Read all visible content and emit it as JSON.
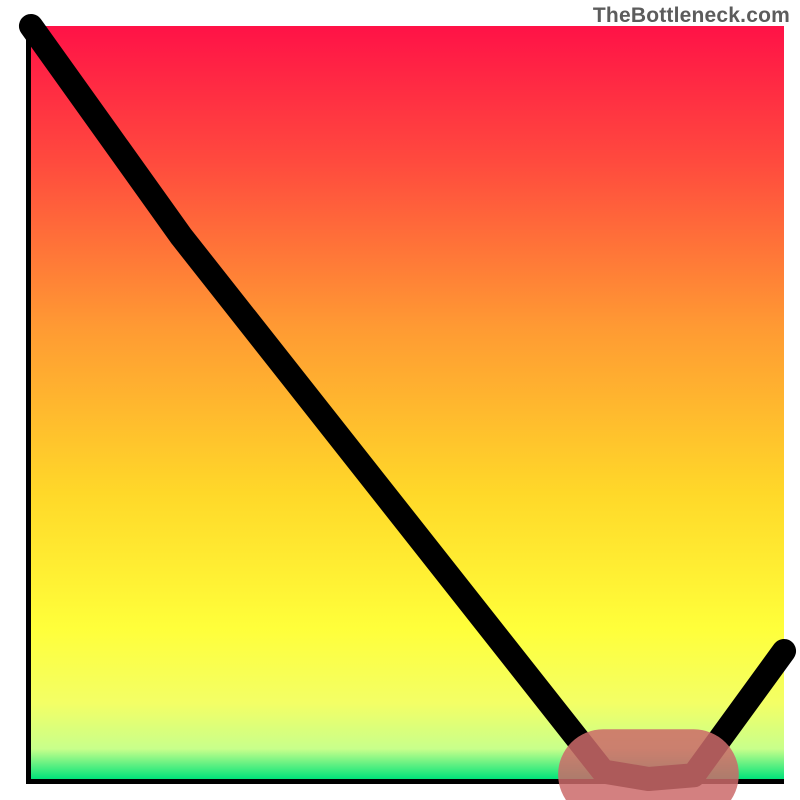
{
  "attribution": "TheBottleneck.com",
  "chart_data": {
    "type": "line",
    "title": "",
    "xlabel": "",
    "ylabel": "",
    "xlim": [
      0,
      100
    ],
    "ylim": [
      0,
      100
    ],
    "curve": [
      {
        "x": 0,
        "y": 100
      },
      {
        "x": 20,
        "y": 72
      },
      {
        "x": 76,
        "y": 1
      },
      {
        "x": 82,
        "y": 0
      },
      {
        "x": 88,
        "y": 0.5
      },
      {
        "x": 100,
        "y": 17
      }
    ],
    "optimal_marker": {
      "x_start": 76,
      "x_end": 88,
      "y": 0.6
    },
    "gradient_stops": [
      {
        "offset": 0.0,
        "color": "#ff1247"
      },
      {
        "offset": 0.18,
        "color": "#ff4a3e"
      },
      {
        "offset": 0.4,
        "color": "#ff9a33"
      },
      {
        "offset": 0.62,
        "color": "#ffd829"
      },
      {
        "offset": 0.8,
        "color": "#ffff3a"
      },
      {
        "offset": 0.9,
        "color": "#f3ff66"
      },
      {
        "offset": 0.96,
        "color": "#c8ff8b"
      },
      {
        "offset": 1.0,
        "color": "#00e37a"
      }
    ]
  }
}
